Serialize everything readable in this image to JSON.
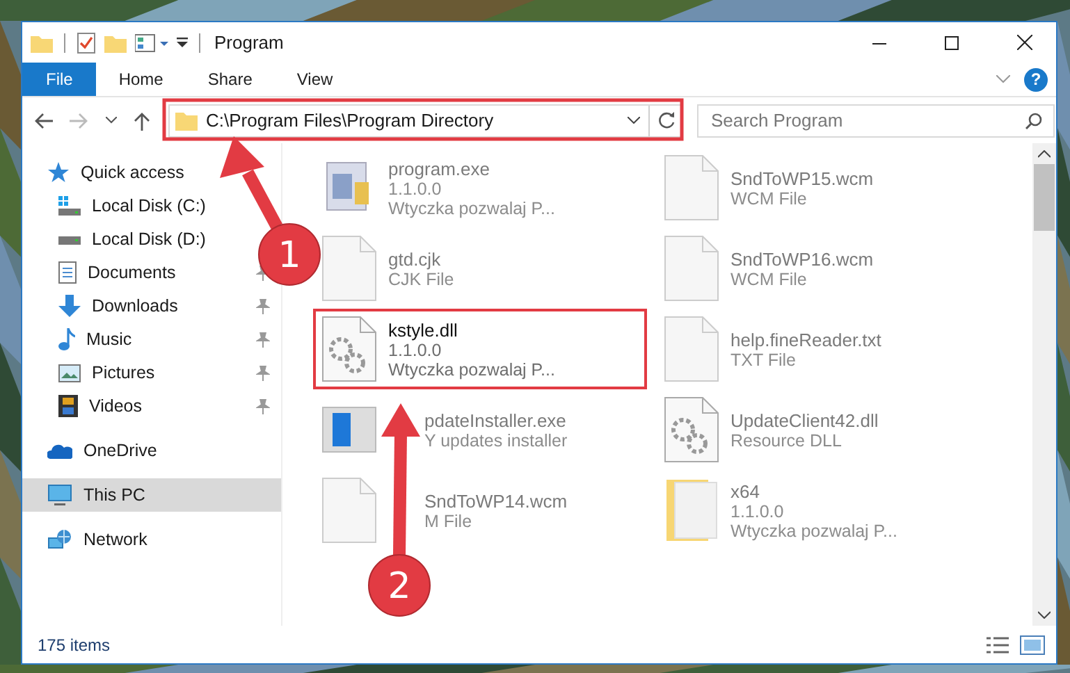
{
  "window": {
    "title": "Program"
  },
  "ribbon": {
    "tabs": [
      {
        "label": "File",
        "selected": true
      },
      {
        "label": "Home",
        "selected": false
      },
      {
        "label": "Share",
        "selected": false
      },
      {
        "label": "View",
        "selected": false
      }
    ],
    "help": "?"
  },
  "address": {
    "path": "C:\\Program Files\\Program Directory"
  },
  "search": {
    "placeholder": "Search Program"
  },
  "nav": [
    {
      "label": "Quick access",
      "selected": false,
      "children": [
        {
          "label": "Local Disk (C:)",
          "pinned": false,
          "selected": false
        },
        {
          "label": "Local Disk (D:)",
          "pinned": false,
          "selected": false
        },
        {
          "label": "Documents",
          "pinned": true,
          "selected": false
        },
        {
          "label": "Downloads",
          "pinned": true,
          "selected": false
        },
        {
          "label": "Music",
          "pinned": true,
          "selected": false
        },
        {
          "label": "Pictures",
          "pinned": true,
          "selected": false
        },
        {
          "label": "Videos",
          "pinned": true,
          "selected": false
        }
      ]
    },
    {
      "label": "OneDrive",
      "selected": false
    },
    {
      "label": "This PC",
      "selected": true
    },
    {
      "label": "Network",
      "selected": false
    }
  ],
  "files": [
    {
      "name": "program.exe",
      "lines": [
        "1.1.0.0",
        "Wtyczka pozwalaj  P..."
      ],
      "kind": "app",
      "focus": false
    },
    {
      "name": "gtd.cjk",
      "lines": [
        "CJK File"
      ],
      "kind": "document",
      "focus": false
    },
    {
      "name": "kstyle.dll",
      "lines": [
        "1.1.0.0",
        "Wtyczka pozwalaj  P..."
      ],
      "kind": "dll",
      "focus": true
    },
    {
      "name": "pdateInstaller.exe",
      "lines": [
        "Y updates installer"
      ],
      "kind": "installer",
      "focus": false
    },
    {
      "name": "SndToWP14.wcm",
      "lines": [
        "M File"
      ],
      "kind": "document",
      "focus": false
    },
    {
      "name": "SndToWP15.wcm",
      "lines": [
        "WCM File"
      ],
      "kind": "document",
      "focus": false
    },
    {
      "name": "SndToWP16.wcm",
      "lines": [
        "WCM File"
      ],
      "kind": "document",
      "focus": false
    },
    {
      "name": "help.fineReader.txt",
      "lines": [
        "TXT File"
      ],
      "kind": "document",
      "focus": false
    },
    {
      "name": "UpdateClient42.dll",
      "lines": [
        "Resource DLL"
      ],
      "kind": "dll",
      "focus": false
    },
    {
      "name": "x64",
      "lines": [
        "1.1.0.0",
        "Wtyczka pozwalaj  P..."
      ],
      "kind": "folder",
      "focus": false
    }
  ],
  "status_bar": {
    "count": "175 items"
  },
  "annotations": [
    {
      "label": "1"
    },
    {
      "label": "2"
    }
  ]
}
